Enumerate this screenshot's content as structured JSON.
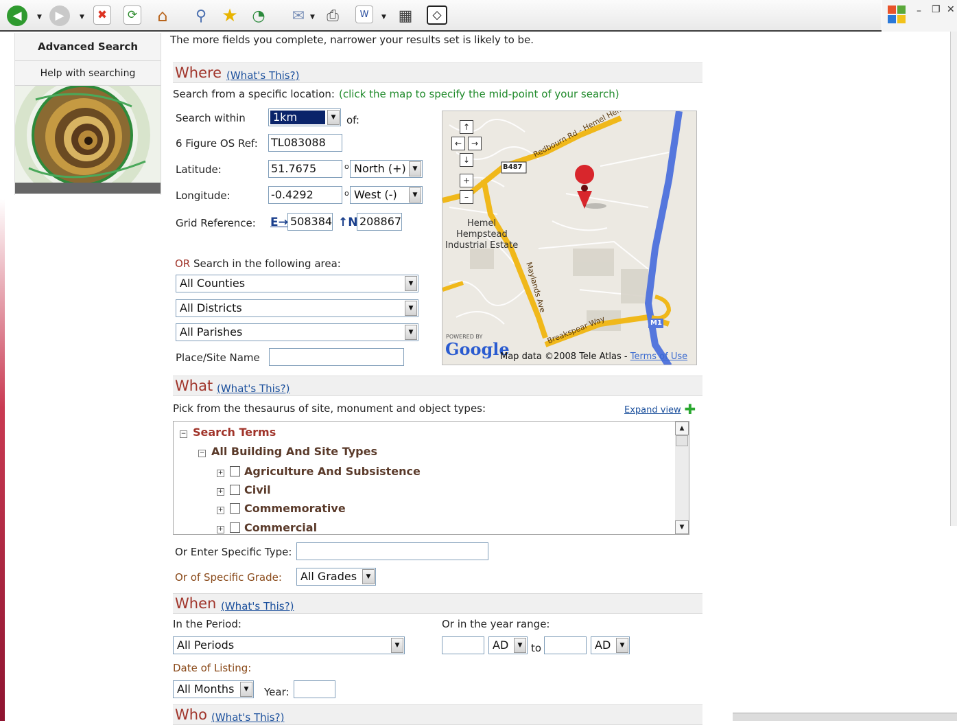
{
  "nav": {
    "advanced_search": "Advanced Search",
    "help": "Help with searching"
  },
  "intro": "The more fields you complete, narrower your results set is likely to be.",
  "where": {
    "title": "Where",
    "whats_this": "(What's This?)",
    "location_prompt": "Search from a specific location:",
    "location_hint": "(click the map to specify the mid-point of your search)",
    "search_within_label": "Search within",
    "search_within_value": "1km",
    "of": "of:",
    "os_ref_label": "6 Figure OS Ref:",
    "os_ref_value": "TL083088",
    "latitude_label": "Latitude:",
    "latitude_value": "51.7675",
    "latitude_dir": "North (+)",
    "longitude_label": "Longitude:",
    "longitude_value": "-0.4292",
    "longitude_dir": "West (-)",
    "degree": "o",
    "grid_ref_label": "Grid Reference:",
    "grid_e_label": "E",
    "grid_e_value": "508384",
    "grid_n_label": "N",
    "grid_n_value": "208867",
    "or_word": "OR",
    "area_prompt": "Search in the following area:",
    "counties": "All Counties",
    "districts": "All Districts",
    "parishes": "All Parishes",
    "place_label": "Place/Site Name",
    "place_value": ""
  },
  "map": {
    "labels": {
      "road_redbourn": "Redbourn Rd - Hemel Hen",
      "b487": "B487",
      "hemel": "Hemel",
      "hempstead": "Hempstead",
      "industrial": "Industrial Estate",
      "maylands": "Maylands Ave",
      "breakspear": "Breakspear Way",
      "m1": "M1"
    },
    "powered_by": "POWERED BY",
    "google": "Google",
    "attribution": "Map data ©2008 Tele Atlas - ",
    "terms": "Terms of Use"
  },
  "what": {
    "title": "What",
    "whats_this": "(What's This?)",
    "prompt": "Pick from the thesaurus of site, monument and object types:",
    "expand": "Expand view",
    "tree": {
      "root": "Search Terms",
      "group": "All Building And Site Types",
      "items": [
        "Agriculture And Subsistence",
        "Civil",
        "Commemorative",
        "Commercial"
      ]
    },
    "specific_type_label": "Or Enter Specific Type:",
    "specific_type_value": "",
    "grade_label": "Or of Specific Grade:",
    "grade_value": "All Grades"
  },
  "when": {
    "title": "When",
    "whats_this": "(What's This?)",
    "period_label": "In the Period:",
    "period_value": "All Periods",
    "year_range_label": "Or in the year range:",
    "era_from": "AD",
    "to": "to",
    "era_to": "AD",
    "listing_label": "Date of Listing:",
    "months_value": "All Months",
    "year_label": "Year:"
  },
  "who": {
    "title": "Who",
    "whats_this": "(What's This?)"
  },
  "colors": {
    "heading": "#a0342a",
    "link": "#1a4f9c",
    "hint_green": "#1f8a2a",
    "road_yellow": "#f0b81a",
    "motorway_blue": "#5577dd",
    "pin_red": "#d8262c"
  }
}
